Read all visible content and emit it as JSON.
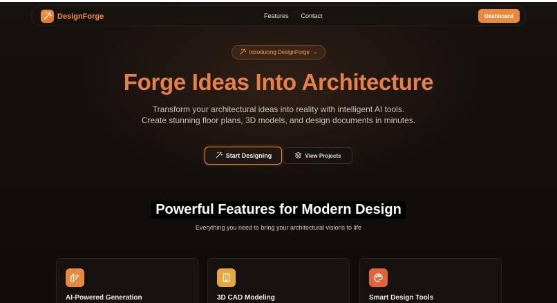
{
  "nav": {
    "brand": "DesignForge",
    "links": [
      "Features",
      "Contact"
    ],
    "dashboard_label": "Dashboard"
  },
  "hero": {
    "pill_label": "Introducing DesignForge",
    "pill_arrow": "→",
    "title": "Forge Ideas Into Architecture",
    "subtitle": "Transform your architectural ideas into reality with intelligent AI tools. Create stunning floor plans, 3D models, and design documents in minutes.",
    "primary_label": "Start Designing",
    "secondary_label": "View Projects"
  },
  "features": {
    "title": "Powerful Features for Modern Design",
    "subtitle": "Everything you need to bring your architectural visions to life",
    "cards": [
      {
        "title": "AI-Powered Generation",
        "icon": "brain-icon",
        "color": "#e88a3e"
      },
      {
        "title": "3D CAD Modeling",
        "icon": "building-icon",
        "color": "#e8a43e"
      },
      {
        "title": "Smart Design Tools",
        "icon": "palette-icon",
        "color": "#e0633a"
      }
    ]
  },
  "colors": {
    "accent": "#e88a3e",
    "title": "#e6804a",
    "background": "#0f0c0a"
  }
}
